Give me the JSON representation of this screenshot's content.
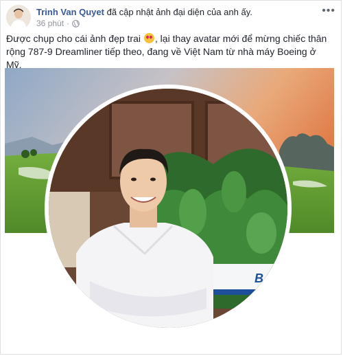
{
  "post": {
    "author": "Trinh Van Quyet",
    "action": "đã cập nhật ảnh đại diện của anh ấy.",
    "time": "36 phút",
    "privacy_icon": "globe-icon",
    "more_icon": "more-options-icon",
    "text_before_emoji": "Được chụp cho cái ảnh đẹp trai",
    "emoji": "heart-eyes-emoji",
    "text_after_emoji": ", lại thay avatar mới để mừng chiếc thân rộng 787-9 Dreamliner tiếp theo, đang về Việt Nam từ nhà máy Boeing ở Mỹ.",
    "aircraft_label": "BAM"
  },
  "colors": {
    "author": "#385898",
    "meta": "#90949c",
    "sky_top": "#8fa8c6",
    "sunset": "#e6935a",
    "grass": "#5f9a34",
    "shirt": "#f4f4f6"
  }
}
